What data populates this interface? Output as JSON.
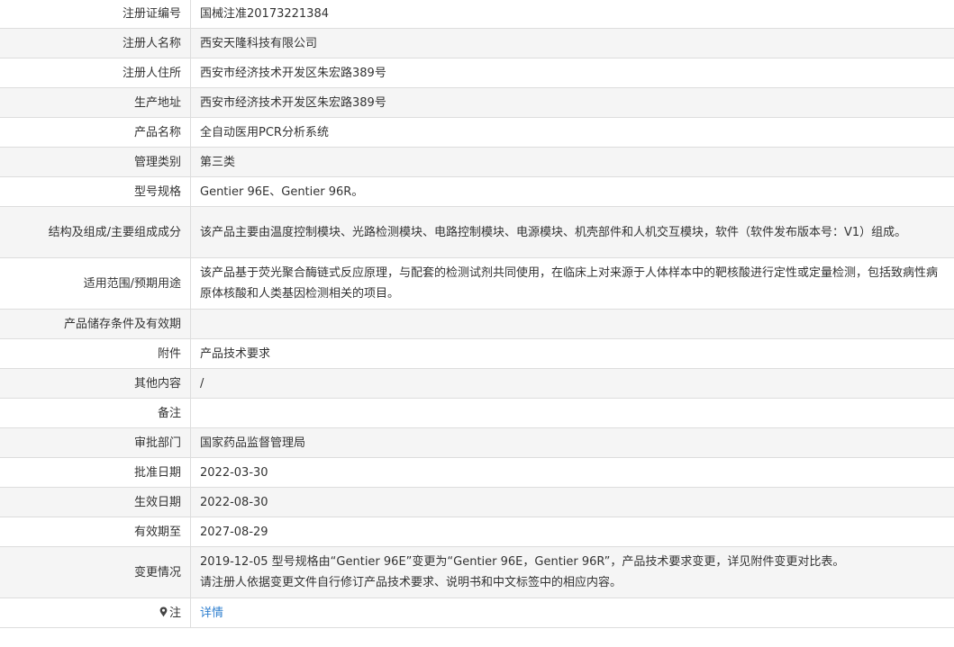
{
  "rows": [
    {
      "label": "注册证编号",
      "value": "国械注准20173221384"
    },
    {
      "label": "注册人名称",
      "value": "西安天隆科技有限公司"
    },
    {
      "label": "注册人住所",
      "value": "西安市经济技术开发区朱宏路389号"
    },
    {
      "label": "生产地址",
      "value": "西安市经济技术开发区朱宏路389号"
    },
    {
      "label": "产品名称",
      "value": "全自动医用PCR分析系统"
    },
    {
      "label": "管理类别",
      "value": "第三类"
    },
    {
      "label": "型号规格",
      "value": "Gentier 96E、Gentier 96R。"
    },
    {
      "label": "结构及组成/主要组成成分",
      "value": "该产品主要由温度控制模块、光路检测模块、电路控制模块、电源模块、机壳部件和人机交互模块，软件（软件发布版本号：V1）组成。"
    },
    {
      "label": "适用范围/预期用途",
      "value": "该产品基于荧光聚合酶链式反应原理，与配套的检测试剂共同使用，在临床上对来源于人体样本中的靶核酸进行定性或定量检测，包括致病性病原体核酸和人类基因检测相关的项目。"
    },
    {
      "label": "产品储存条件及有效期",
      "value": ""
    },
    {
      "label": "附件",
      "value": "产品技术要求"
    },
    {
      "label": "其他内容",
      "value": "/"
    },
    {
      "label": "备注",
      "value": ""
    },
    {
      "label": "审批部门",
      "value": "国家药品监督管理局"
    },
    {
      "label": "批准日期",
      "value": "2022-03-30"
    },
    {
      "label": "生效日期",
      "value": "2022-08-30"
    },
    {
      "label": "有效期至",
      "value": "2027-08-29"
    }
  ],
  "change": {
    "label": "变更情况",
    "line1": "2019-12-05 型号规格由“Gentier 96E”变更为“Gentier 96E，Gentier 96R”，产品技术要求变更，详见附件变更对比表。",
    "line2": "请注册人依据变更文件自行修订产品技术要求、说明书和中文标签中的相应内容。"
  },
  "note": {
    "label": "注",
    "link_text": "详情",
    "icon": "map-pin-icon",
    "link_color": "#2f7fcf"
  }
}
